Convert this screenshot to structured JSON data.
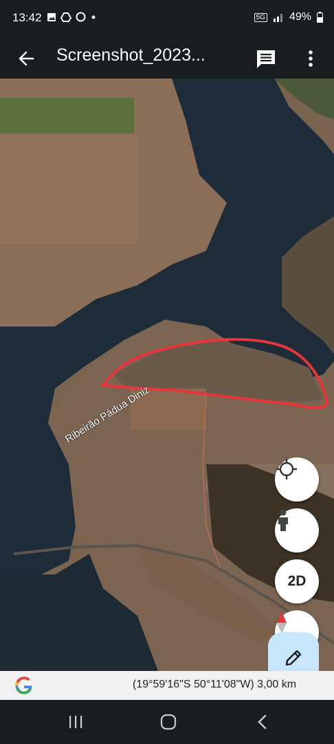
{
  "status": {
    "time": "13:42",
    "battery": "49%",
    "network": "5G"
  },
  "appbar": {
    "title": "Screenshot_2023...",
    "icons": [
      "back-arrow-icon",
      "comment-icon",
      "more-vert-icon"
    ]
  },
  "map": {
    "river_label": "Ribeirão Pádua Diniz",
    "controls": [
      "my-location-icon",
      "street-view-icon",
      "2D",
      "compass-icon"
    ],
    "view_mode": "2D"
  },
  "footer": {
    "coordinates": "(19°59'16\"S 50°11'08\"W) 3,00 km"
  },
  "colors": {
    "annotation": "#e8353c",
    "water": "#1e2b38",
    "edit_fab": "#c8e6fb"
  }
}
